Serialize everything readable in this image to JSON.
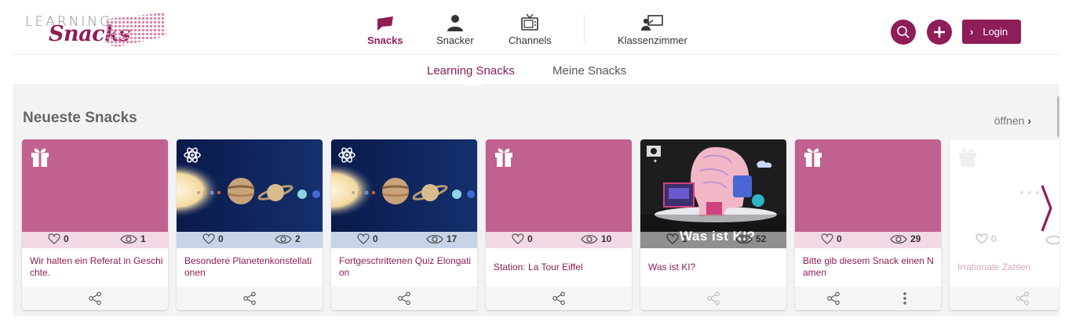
{
  "brand": {
    "logo_top": "LEARNING",
    "logo_bottom": "Snacks",
    "accent_color": "#8e1d58",
    "card_pink": "#c0618f"
  },
  "nav": {
    "items": [
      {
        "label": "Snacks",
        "icon": "snack-icon",
        "active": true
      },
      {
        "label": "Snacker",
        "icon": "person-icon",
        "active": false
      },
      {
        "label": "Channels",
        "icon": "tv-icon",
        "active": false
      },
      {
        "label": "Klassenzimmer",
        "icon": "classroom-icon",
        "active": false
      }
    ]
  },
  "actions": {
    "search_icon": "search-icon",
    "add_icon": "plus-icon",
    "login_label": "Login"
  },
  "subnav": {
    "tabs": [
      {
        "label": "Learning Snacks",
        "active": true
      },
      {
        "label": "Meine Snacks",
        "active": false
      }
    ]
  },
  "section": {
    "title": "Neueste Snacks",
    "open_label": "öffnen"
  },
  "cards": [
    {
      "title": "Wir halten ein Referat in Geschi chte.",
      "likes": "0",
      "views": "1",
      "image": "gift-placeholder"
    },
    {
      "title": "Besondere Planetenkonstellati onen",
      "likes": "0",
      "views": "2",
      "image": "planets"
    },
    {
      "title": "Fortgeschrittenen Quiz Elongati on",
      "likes": "0",
      "views": "17",
      "image": "planets"
    },
    {
      "title": "Station: La Tour Eiffel",
      "likes": "0",
      "views": "10",
      "image": "gift-placeholder"
    },
    {
      "title": "Was ist KI?",
      "likes": "1",
      "views": "52",
      "image": "ai-illustration",
      "image_caption": "Was ist KI?"
    },
    {
      "title": "Bitte gib diesem Snack einen N amen",
      "likes": "0",
      "views": "29",
      "image": "gift-placeholder"
    },
    {
      "title": "Irrationale Zahlen",
      "likes": "0",
      "views": "",
      "image": "gift-placeholder"
    }
  ]
}
